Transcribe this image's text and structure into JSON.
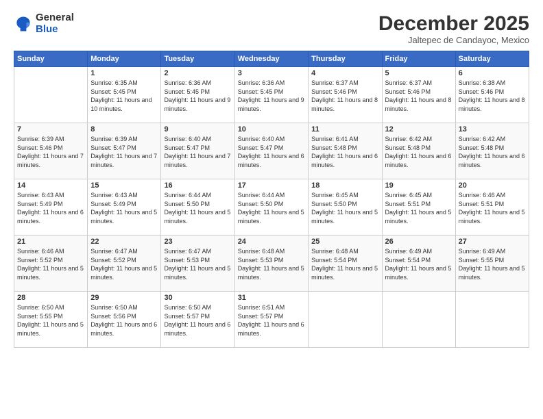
{
  "logo": {
    "general": "General",
    "blue": "Blue"
  },
  "title": "December 2025",
  "subtitle": "Jaltepec de Candayoc, Mexico",
  "days_of_week": [
    "Sunday",
    "Monday",
    "Tuesday",
    "Wednesday",
    "Thursday",
    "Friday",
    "Saturday"
  ],
  "weeks": [
    [
      {
        "day": "",
        "info": ""
      },
      {
        "day": "1",
        "info": "Sunrise: 6:35 AM\nSunset: 5:45 PM\nDaylight: 11 hours and 10 minutes."
      },
      {
        "day": "2",
        "info": "Sunrise: 6:36 AM\nSunset: 5:45 PM\nDaylight: 11 hours and 9 minutes."
      },
      {
        "day": "3",
        "info": "Sunrise: 6:36 AM\nSunset: 5:45 PM\nDaylight: 11 hours and 9 minutes."
      },
      {
        "day": "4",
        "info": "Sunrise: 6:37 AM\nSunset: 5:46 PM\nDaylight: 11 hours and 8 minutes."
      },
      {
        "day": "5",
        "info": "Sunrise: 6:37 AM\nSunset: 5:46 PM\nDaylight: 11 hours and 8 minutes."
      },
      {
        "day": "6",
        "info": "Sunrise: 6:38 AM\nSunset: 5:46 PM\nDaylight: 11 hours and 8 minutes."
      }
    ],
    [
      {
        "day": "7",
        "info": "Sunrise: 6:39 AM\nSunset: 5:46 PM\nDaylight: 11 hours and 7 minutes."
      },
      {
        "day": "8",
        "info": "Sunrise: 6:39 AM\nSunset: 5:47 PM\nDaylight: 11 hours and 7 minutes."
      },
      {
        "day": "9",
        "info": "Sunrise: 6:40 AM\nSunset: 5:47 PM\nDaylight: 11 hours and 7 minutes."
      },
      {
        "day": "10",
        "info": "Sunrise: 6:40 AM\nSunset: 5:47 PM\nDaylight: 11 hours and 6 minutes."
      },
      {
        "day": "11",
        "info": "Sunrise: 6:41 AM\nSunset: 5:48 PM\nDaylight: 11 hours and 6 minutes."
      },
      {
        "day": "12",
        "info": "Sunrise: 6:42 AM\nSunset: 5:48 PM\nDaylight: 11 hours and 6 minutes."
      },
      {
        "day": "13",
        "info": "Sunrise: 6:42 AM\nSunset: 5:48 PM\nDaylight: 11 hours and 6 minutes."
      }
    ],
    [
      {
        "day": "14",
        "info": "Sunrise: 6:43 AM\nSunset: 5:49 PM\nDaylight: 11 hours and 6 minutes."
      },
      {
        "day": "15",
        "info": "Sunrise: 6:43 AM\nSunset: 5:49 PM\nDaylight: 11 hours and 5 minutes."
      },
      {
        "day": "16",
        "info": "Sunrise: 6:44 AM\nSunset: 5:50 PM\nDaylight: 11 hours and 5 minutes."
      },
      {
        "day": "17",
        "info": "Sunrise: 6:44 AM\nSunset: 5:50 PM\nDaylight: 11 hours and 5 minutes."
      },
      {
        "day": "18",
        "info": "Sunrise: 6:45 AM\nSunset: 5:50 PM\nDaylight: 11 hours and 5 minutes."
      },
      {
        "day": "19",
        "info": "Sunrise: 6:45 AM\nSunset: 5:51 PM\nDaylight: 11 hours and 5 minutes."
      },
      {
        "day": "20",
        "info": "Sunrise: 6:46 AM\nSunset: 5:51 PM\nDaylight: 11 hours and 5 minutes."
      }
    ],
    [
      {
        "day": "21",
        "info": "Sunrise: 6:46 AM\nSunset: 5:52 PM\nDaylight: 11 hours and 5 minutes."
      },
      {
        "day": "22",
        "info": "Sunrise: 6:47 AM\nSunset: 5:52 PM\nDaylight: 11 hours and 5 minutes."
      },
      {
        "day": "23",
        "info": "Sunrise: 6:47 AM\nSunset: 5:53 PM\nDaylight: 11 hours and 5 minutes."
      },
      {
        "day": "24",
        "info": "Sunrise: 6:48 AM\nSunset: 5:53 PM\nDaylight: 11 hours and 5 minutes."
      },
      {
        "day": "25",
        "info": "Sunrise: 6:48 AM\nSunset: 5:54 PM\nDaylight: 11 hours and 5 minutes."
      },
      {
        "day": "26",
        "info": "Sunrise: 6:49 AM\nSunset: 5:54 PM\nDaylight: 11 hours and 5 minutes."
      },
      {
        "day": "27",
        "info": "Sunrise: 6:49 AM\nSunset: 5:55 PM\nDaylight: 11 hours and 5 minutes."
      }
    ],
    [
      {
        "day": "28",
        "info": "Sunrise: 6:50 AM\nSunset: 5:55 PM\nDaylight: 11 hours and 5 minutes."
      },
      {
        "day": "29",
        "info": "Sunrise: 6:50 AM\nSunset: 5:56 PM\nDaylight: 11 hours and 6 minutes."
      },
      {
        "day": "30",
        "info": "Sunrise: 6:50 AM\nSunset: 5:57 PM\nDaylight: 11 hours and 6 minutes."
      },
      {
        "day": "31",
        "info": "Sunrise: 6:51 AM\nSunset: 5:57 PM\nDaylight: 11 hours and 6 minutes."
      },
      {
        "day": "",
        "info": ""
      },
      {
        "day": "",
        "info": ""
      },
      {
        "day": "",
        "info": ""
      }
    ]
  ]
}
